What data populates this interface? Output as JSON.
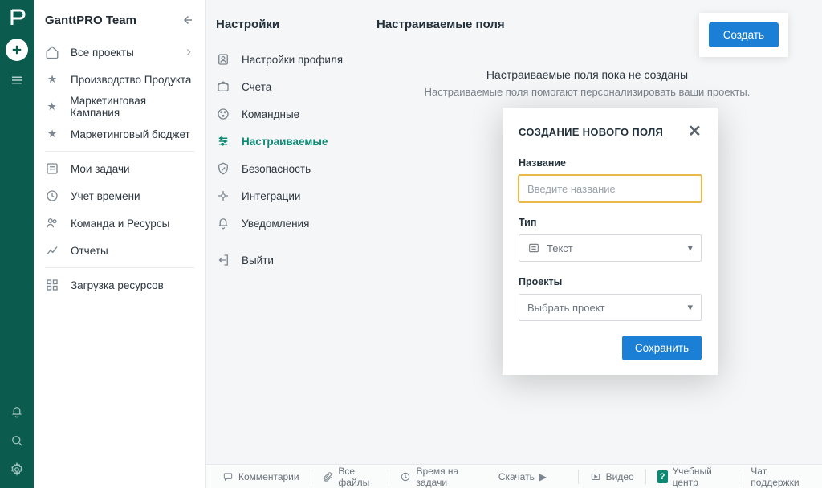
{
  "team_name": "GanttPRO Team",
  "nav": {
    "all_projects": "Все проекты",
    "projects": [
      "Производство Продукта",
      "Маркетинговая Кампания",
      "Маркетинговый бюджет"
    ],
    "my_tasks": "Мои задачи",
    "time_tracking": "Учет времени",
    "team_resources": "Команда и Ресурсы",
    "reports": "Отчеты",
    "workload": "Загрузка ресурсов"
  },
  "settings": {
    "title": "Настройки",
    "profile": "Настройки профиля",
    "billing": "Счета",
    "team": "Командные",
    "custom": "Настраиваемые",
    "security": "Безопасность",
    "integrations": "Интеграции",
    "notifications": "Уведомления",
    "logout": "Выйти"
  },
  "pane": {
    "title": "Настраиваемые поля",
    "create": "Создать",
    "empty_title": "Настраиваемые поля пока не созданы",
    "empty_sub": "Настраиваемые поля помогают персонализировать ваши проекты."
  },
  "modal": {
    "title": "СОЗДАНИЕ НОВОГО ПОЛЯ",
    "name_label": "Название",
    "name_placeholder": "Введите название",
    "type_label": "Тип",
    "type_value": "Текст",
    "projects_label": "Проекты",
    "projects_placeholder": "Выбрать проект",
    "save": "Сохранить"
  },
  "footer": {
    "comments": "Комментарии",
    "files": "Все файлы",
    "time": "Время на задачи",
    "download": "Скачать",
    "video": "Видео",
    "learning": "Учебный центр",
    "chat": "Чат поддержки"
  }
}
